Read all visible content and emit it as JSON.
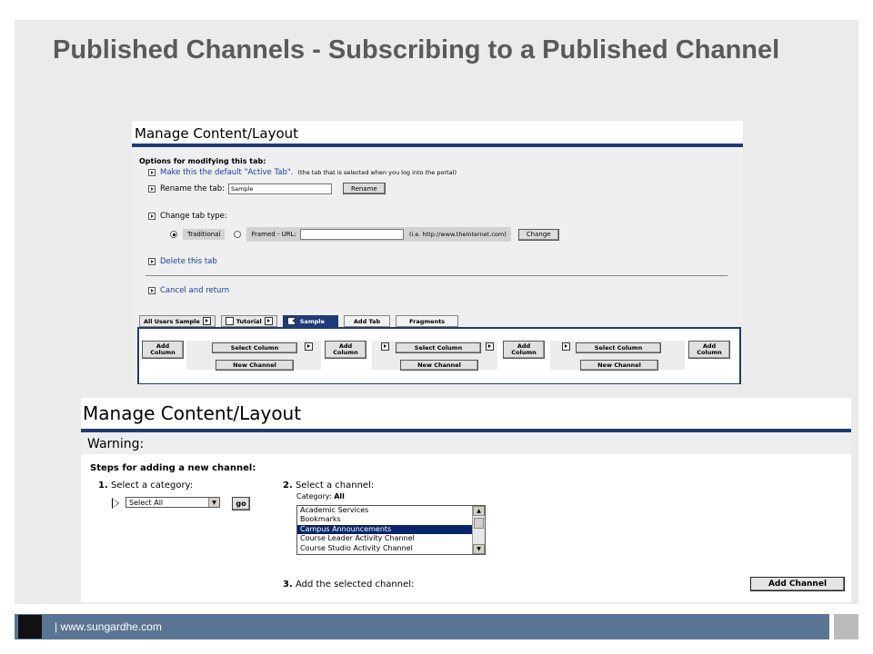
{
  "slide": {
    "title": "Published Channels - Subscribing to a Published Channel",
    "footer": "| www.sungardhe.com"
  },
  "screenshot1": {
    "title": "Manage Content/Layout",
    "options_heading": "Options for modifying this tab:",
    "make_default_link": "Make this the default \"Active Tab\".",
    "make_default_note": "(the tab that is selected when you log into the portal)",
    "rename_label": "Rename the tab:",
    "rename_value": "Sample",
    "rename_button": "Rename",
    "change_type_label": "Change tab type:",
    "traditional_label": "Traditional",
    "framed_label": "Framed  -  URL:",
    "url_value": "",
    "url_hint": "(i.e. http://www.theInternet.com)",
    "change_button": "Change",
    "delete_link": "Delete this tab",
    "cancel_link": "Cancel and return",
    "tabs": [
      "All Users Sample",
      "Tutorial",
      "Sample",
      "Add Tab",
      "Fragments"
    ],
    "add_column": "Add Column",
    "select_column": "Select Column",
    "new_channel": "New Channel"
  },
  "screenshot2": {
    "title": "Manage Content/Layout",
    "warning": "Warning:",
    "steps_heading": "Steps for adding a new channel:",
    "step1_num": "1.",
    "step1_label": "Select a category:",
    "category_selected": "Select All",
    "go_button": "go",
    "step2_num": "2.",
    "step2_label": "Select a channel:",
    "category_label": "Category:",
    "category_value": "All",
    "channels": [
      "Academic Services",
      "Bookmarks",
      "Campus Announcements",
      "Course Leader Activity Channel",
      "Course Studio Activity Channel"
    ],
    "selected_channel": "Campus Announcements",
    "step3_num": "3.",
    "step3_label": "Add the selected channel:",
    "add_channel_button": "Add Channel"
  },
  "colors": {
    "title_gray": "#5a5a5a",
    "portal_blue": "#1e3b78",
    "link_blue": "#1c3e9e",
    "footer_blue": "#5a7594"
  }
}
